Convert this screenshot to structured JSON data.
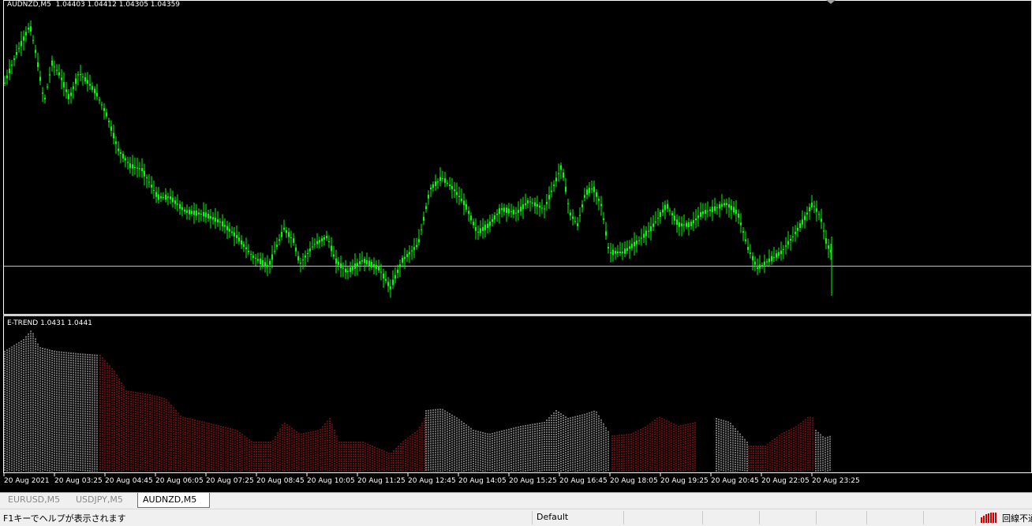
{
  "chart": {
    "price_header": "AUDNZD,M5  1.04403 1.04412 1.04305 1.04359",
    "indicator_header": "E-TREND 1.0431 1.0441",
    "colors": {
      "bull": "#00ff00",
      "bull_hist": "#e0e0e0",
      "bear_hist": "#cc1a1a",
      "grid_line": "#c0c0c0",
      "axis": "#ffffff"
    },
    "time_labels": [
      "20 Aug 2021",
      "20 Aug 03:25",
      "20 Aug 04:45",
      "20 Aug 06:05",
      "20 Aug 07:25",
      "20 Aug 08:45",
      "20 Aug 10:05",
      "20 Aug 11:25",
      "20 Aug 12:45",
      "20 Aug 14:05",
      "20 Aug 15:25",
      "20 Aug 16:45",
      "20 Aug 18:05",
      "20 Aug 19:25",
      "20 Aug 20:45",
      "20 Aug 22:05",
      "20 Aug 23:25"
    ]
  },
  "tabs": [
    {
      "label": "EURUSD,M5",
      "active": false
    },
    {
      "label": "USDJPY,M5",
      "active": false
    },
    {
      "label": "AUDNZD,M5",
      "active": true
    }
  ],
  "status": {
    "help_text": "F1キーでヘルプが表示されます",
    "profile": "Default",
    "connection": "回線不通",
    "connection_icon": "connection-bars-icon"
  }
}
